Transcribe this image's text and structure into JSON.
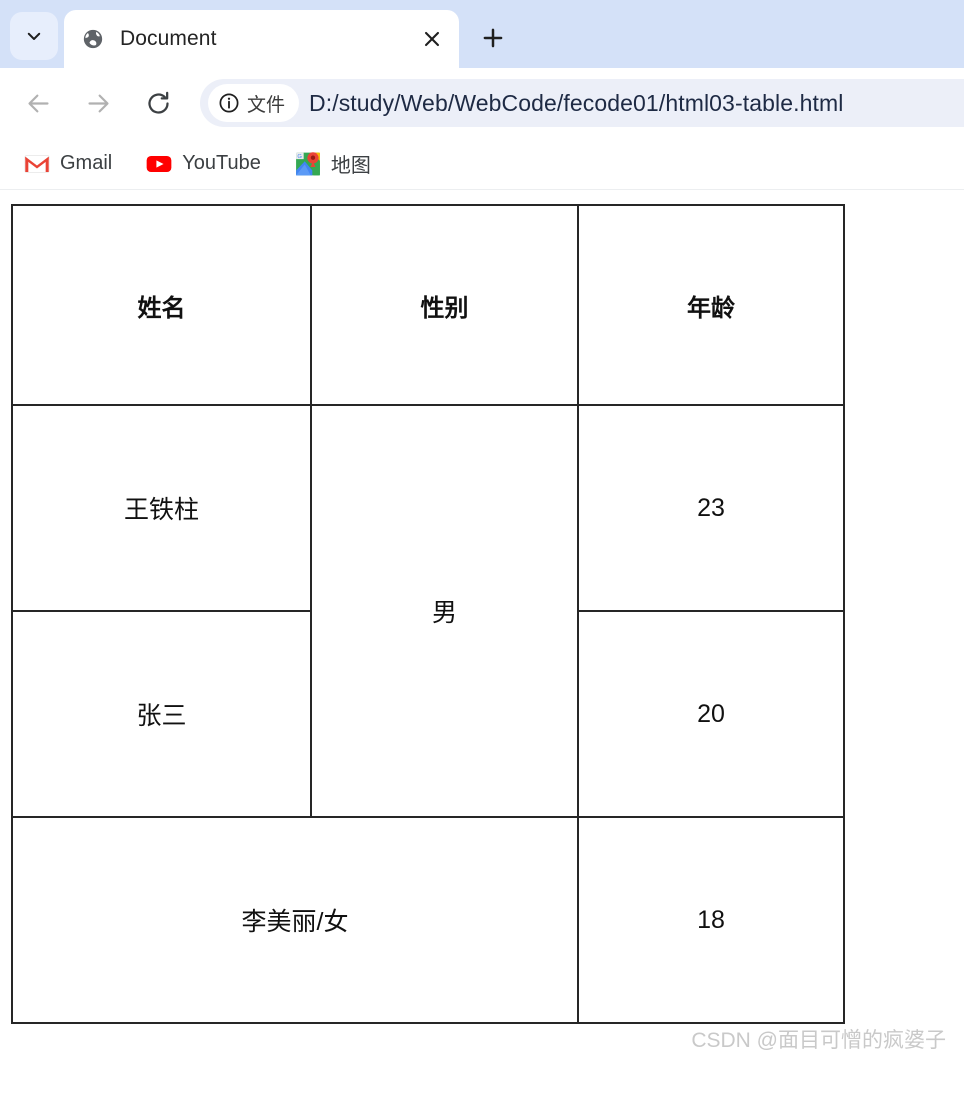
{
  "browser": {
    "tab_search": {
      "name": "tab-search",
      "icon": "chevron-down-icon"
    },
    "tabs": [
      {
        "title": "Document",
        "favicon": "globe-icon",
        "active": true
      }
    ],
    "close_tab_label": "×",
    "new_tab_label": "+",
    "toolbar": {
      "back_label": "←",
      "forward_label": "→",
      "reload_label": "↻",
      "omnibox": {
        "chip_label": "文件",
        "chip_icon": "info-circle-icon",
        "url": "D:/study/Web/WebCode/fecode01/html03-table.html"
      }
    },
    "bookmarks": [
      {
        "label": "Gmail",
        "icon": "gmail-icon"
      },
      {
        "label": "YouTube",
        "icon": "youtube-icon"
      },
      {
        "label": "地图",
        "icon": "google-maps-icon"
      }
    ]
  },
  "page": {
    "table": {
      "headers": [
        "姓名",
        "性别",
        "年龄"
      ],
      "rows": [
        {
          "name": "王铁柱",
          "gender": "男",
          "age": "23"
        },
        {
          "name": "张三",
          "age": "20"
        },
        {
          "name_gender": "李美丽/女",
          "age": "18"
        }
      ]
    },
    "watermark": "CSDN @面目可憎的疯婆子"
  },
  "colors": {
    "tabstrip_bg": "#d4e1f8",
    "omnibox_bg": "#eceff8",
    "table_border": "#262626",
    "watermark": "#c9c9c9"
  }
}
